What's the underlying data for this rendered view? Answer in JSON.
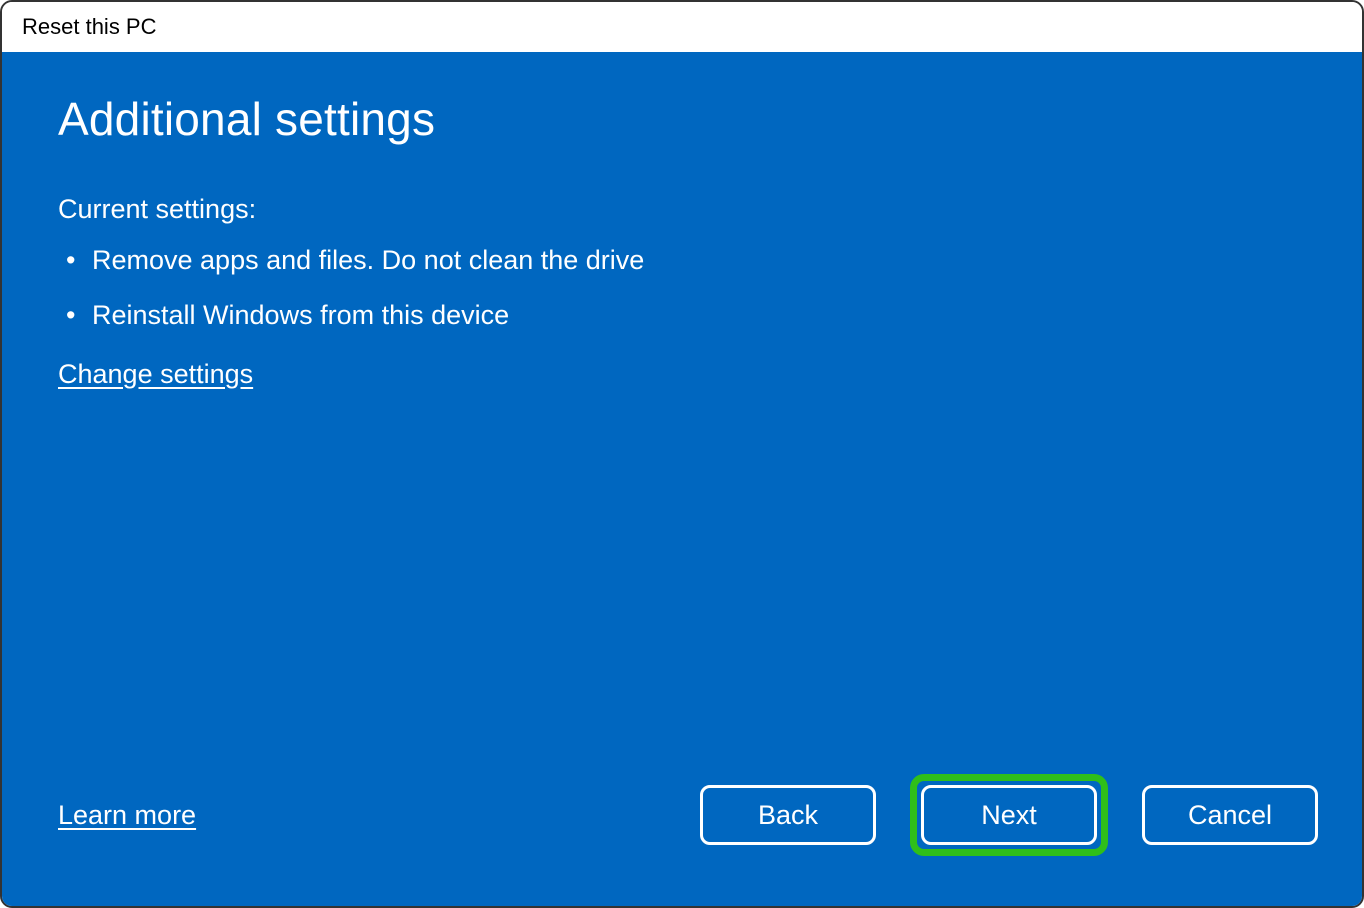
{
  "window": {
    "title": "Reset this PC"
  },
  "main": {
    "heading": "Additional settings",
    "subheading": "Current settings:",
    "settings": [
      "Remove apps and files. Do not clean the drive",
      "Reinstall Windows from this device"
    ],
    "change_link": "Change settings"
  },
  "footer": {
    "learn_more": "Learn more",
    "buttons": {
      "back": "Back",
      "next": "Next",
      "cancel": "Cancel"
    }
  }
}
